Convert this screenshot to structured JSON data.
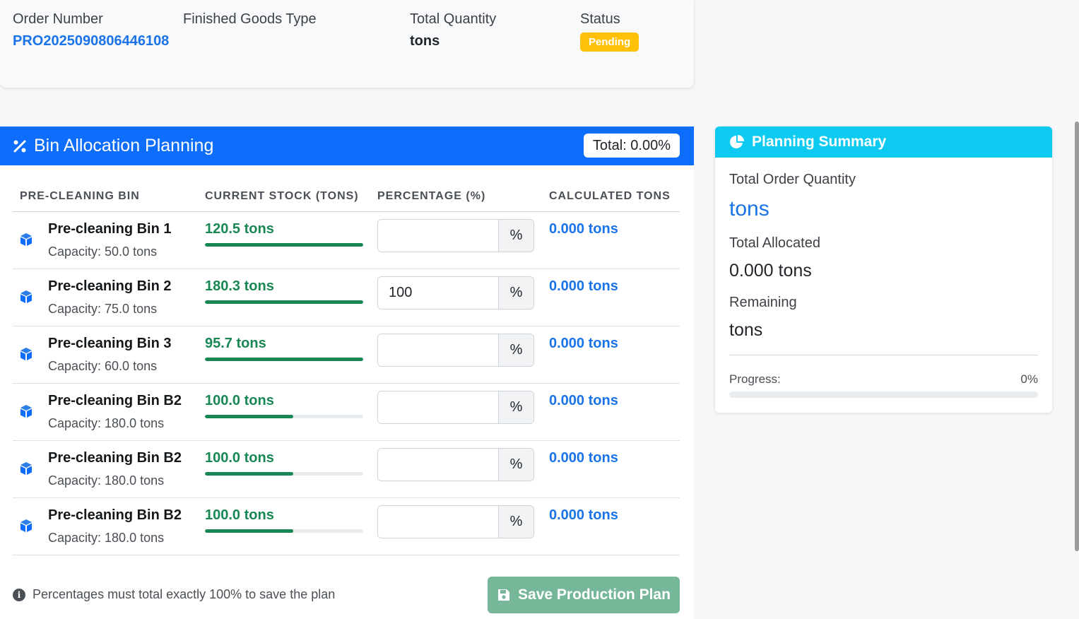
{
  "order": {
    "order_number_label": "Order Number",
    "order_number": "PRO2025090806446108",
    "goods_type_label": "Finished Goods Type",
    "goods_type": "",
    "total_quantity_label": "Total Quantity",
    "total_quantity": "tons",
    "status_label": "Status",
    "status": "Pending"
  },
  "planning": {
    "title": "Bin Allocation Planning",
    "total_pill": "Total: 0.00%",
    "columns": [
      "PRE-CLEANING BIN",
      "CURRENT STOCK (TONS)",
      "PERCENTAGE (%)",
      "CALCULATED TONS"
    ],
    "percent_suffix": "%",
    "rows": [
      {
        "name": "Pre-cleaning Bin 1",
        "capacity": "Capacity: 50.0 tons",
        "stock": "120.5 tons",
        "stock_fill": 1.0,
        "percentage": "",
        "calculated": "0.000 tons"
      },
      {
        "name": "Pre-cleaning Bin 2",
        "capacity": "Capacity: 75.0 tons",
        "stock": "180.3 tons",
        "stock_fill": 1.0,
        "percentage": "100",
        "calculated": "0.000 tons"
      },
      {
        "name": "Pre-cleaning Bin 3",
        "capacity": "Capacity: 60.0 tons",
        "stock": "95.7 tons",
        "stock_fill": 1.0,
        "percentage": "",
        "calculated": "0.000 tons"
      },
      {
        "name": "Pre-cleaning Bin B2",
        "capacity": "Capacity: 180.0 tons",
        "stock": "100.0 tons",
        "stock_fill": 0.556,
        "percentage": "",
        "calculated": "0.000 tons"
      },
      {
        "name": "Pre-cleaning Bin B2",
        "capacity": "Capacity: 180.0 tons",
        "stock": "100.0 tons",
        "stock_fill": 0.556,
        "percentage": "",
        "calculated": "0.000 tons"
      },
      {
        "name": "Pre-cleaning Bin B2",
        "capacity": "Capacity: 180.0 tons",
        "stock": "100.0 tons",
        "stock_fill": 0.556,
        "percentage": "",
        "calculated": "0.000 tons"
      }
    ],
    "footnote": "Percentages must total exactly 100% to save the plan",
    "save_label": "Save Production Plan"
  },
  "summary": {
    "title": "Planning Summary",
    "order_qty_label": "Total Order Quantity",
    "order_qty": "tons",
    "allocated_label": "Total Allocated",
    "allocated": "0.000 tons",
    "remaining_label": "Remaining",
    "remaining": "tons",
    "progress_label": "Progress:",
    "progress_value": "0%",
    "progress_fraction": 0
  },
  "colors": {
    "primary": "#0d6efd",
    "info": "#0dcaf0",
    "success": "#198754",
    "warning": "#ffc107",
    "save_button": "#75b798",
    "link": "#1a73e8"
  },
  "icons": {
    "header": "percent-icon",
    "row": "cube-icon",
    "summary": "pie-chart-icon",
    "footnote": "info-circle-icon",
    "save": "floppy-disk-icon"
  }
}
